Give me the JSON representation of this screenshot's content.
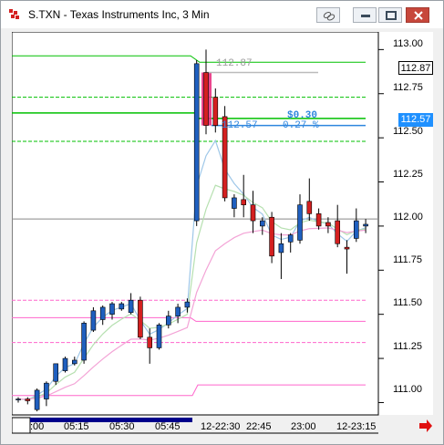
{
  "window": {
    "title": "S.TXN - Texas Instruments Inc, 3 Min",
    "buttons": [
      "link-icon",
      "minimize-icon",
      "restore-icon",
      "close-icon"
    ]
  },
  "colors": {
    "up_candle": "#1f5fbf",
    "down_candle": "#d42020",
    "box_highlight": "#e8247a",
    "green_line": "#00c000",
    "pink_line": "#ff66cc",
    "ma_light_blue": "#9ec7e8",
    "ma_light_green": "#b6e0b0",
    "ma_pink": "#f3a3d6",
    "annotation_blue": "#2e86de",
    "annotation_gray": "#999999"
  },
  "axis": {
    "price_labels": [
      "113.00",
      "112.75",
      "112.50",
      "112.25",
      "112.00",
      "111.75",
      "111.50",
      "111.25",
      "111.00"
    ],
    "time_labels": [
      ":00",
      "05:15",
      "05:30",
      "05:45",
      "12-22:30",
      "22:45",
      "23:00",
      "12-23:15"
    ],
    "last_price_box": "112.87",
    "current_price_box": "112.57"
  },
  "annotations": {
    "top_price": "112.87",
    "entry_price": "112.57",
    "gain": "$0.30",
    "gain_pct": "0.27 %"
  },
  "chart_data": {
    "type": "candlestick",
    "y_range": [
      110.93,
      113.1
    ],
    "candles": [
      {
        "o": 111.02,
        "h": 111.03,
        "l": 111.0,
        "c": 111.02
      },
      {
        "o": 111.02,
        "h": 111.03,
        "l": 110.99,
        "c": 111.01
      },
      {
        "o": 110.96,
        "h": 111.08,
        "l": 110.95,
        "c": 111.07
      },
      {
        "o": 111.02,
        "h": 111.12,
        "l": 110.98,
        "c": 111.11
      },
      {
        "o": 111.12,
        "h": 111.2,
        "l": 111.1,
        "c": 111.22
      },
      {
        "o": 111.18,
        "h": 111.26,
        "l": 111.17,
        "c": 111.25
      },
      {
        "o": 111.22,
        "h": 111.26,
        "l": 111.21,
        "c": 111.24
      },
      {
        "o": 111.24,
        "h": 111.46,
        "l": 111.22,
        "c": 111.45
      },
      {
        "o": 111.41,
        "h": 111.54,
        "l": 111.4,
        "c": 111.52
      },
      {
        "o": 111.47,
        "h": 111.55,
        "l": 111.44,
        "c": 111.54
      },
      {
        "o": 111.5,
        "h": 111.57,
        "l": 111.47,
        "c": 111.56
      },
      {
        "o": 111.53,
        "h": 111.57,
        "l": 111.52,
        "c": 111.56
      },
      {
        "o": 111.51,
        "h": 111.62,
        "l": 111.5,
        "c": 111.58
      },
      {
        "o": 111.58,
        "h": 111.6,
        "l": 111.36,
        "c": 111.37
      },
      {
        "o": 111.37,
        "h": 111.42,
        "l": 111.22,
        "c": 111.31
      },
      {
        "o": 111.31,
        "h": 111.45,
        "l": 111.3,
        "c": 111.44
      },
      {
        "o": 111.44,
        "h": 111.52,
        "l": 111.42,
        "c": 111.49
      },
      {
        "o": 111.49,
        "h": 111.56,
        "l": 111.45,
        "c": 111.54
      },
      {
        "o": 111.54,
        "h": 111.59,
        "l": 111.51,
        "c": 111.57
      },
      {
        "o": 112.03,
        "h": 112.94,
        "l": 112.0,
        "c": 112.92
      },
      {
        "o": 112.87,
        "h": 113.0,
        "l": 112.52,
        "c": 112.57
      },
      {
        "o": 112.73,
        "h": 112.78,
        "l": 112.53,
        "c": 112.57
      },
      {
        "o": 112.62,
        "h": 112.68,
        "l": 112.14,
        "c": 112.16
      },
      {
        "o": 112.1,
        "h": 112.18,
        "l": 112.05,
        "c": 112.16
      },
      {
        "o": 112.15,
        "h": 112.29,
        "l": 112.05,
        "c": 112.12
      },
      {
        "o": 112.12,
        "h": 112.2,
        "l": 111.96,
        "c": 112.03
      },
      {
        "o": 112.0,
        "h": 112.05,
        "l": 111.95,
        "c": 112.03
      },
      {
        "o": 112.05,
        "h": 112.08,
        "l": 111.79,
        "c": 111.83
      },
      {
        "o": 111.85,
        "h": 111.96,
        "l": 111.7,
        "c": 111.9
      },
      {
        "o": 111.91,
        "h": 111.96,
        "l": 111.85,
        "c": 111.95
      },
      {
        "o": 111.92,
        "h": 112.18,
        "l": 111.9,
        "c": 112.12
      },
      {
        "o": 112.14,
        "h": 112.27,
        "l": 112.03,
        "c": 112.07
      },
      {
        "o": 112.07,
        "h": 112.1,
        "l": 111.98,
        "c": 112.0
      },
      {
        "o": 112.02,
        "h": 112.05,
        "l": 111.96,
        "c": 112.0
      },
      {
        "o": 112.03,
        "h": 112.12,
        "l": 111.88,
        "c": 111.9
      },
      {
        "o": 111.88,
        "h": 111.92,
        "l": 111.73,
        "c": 111.87
      },
      {
        "o": 111.93,
        "h": 112.1,
        "l": 111.91,
        "c": 112.03
      },
      {
        "o": 112.0,
        "h": 112.04,
        "l": 111.96,
        "c": 112.01
      }
    ],
    "horizontal_lines": {
      "green_solid": [
        112.61
      ],
      "green_dashed": [
        112.98,
        112.73,
        112.48
      ],
      "pink_solid": [
        111.46
      ],
      "pink_dashed": [
        111.58,
        111.34
      ],
      "pink_band_low": [
        111.1
      ],
      "gray_reference": [
        112.04
      ]
    }
  }
}
